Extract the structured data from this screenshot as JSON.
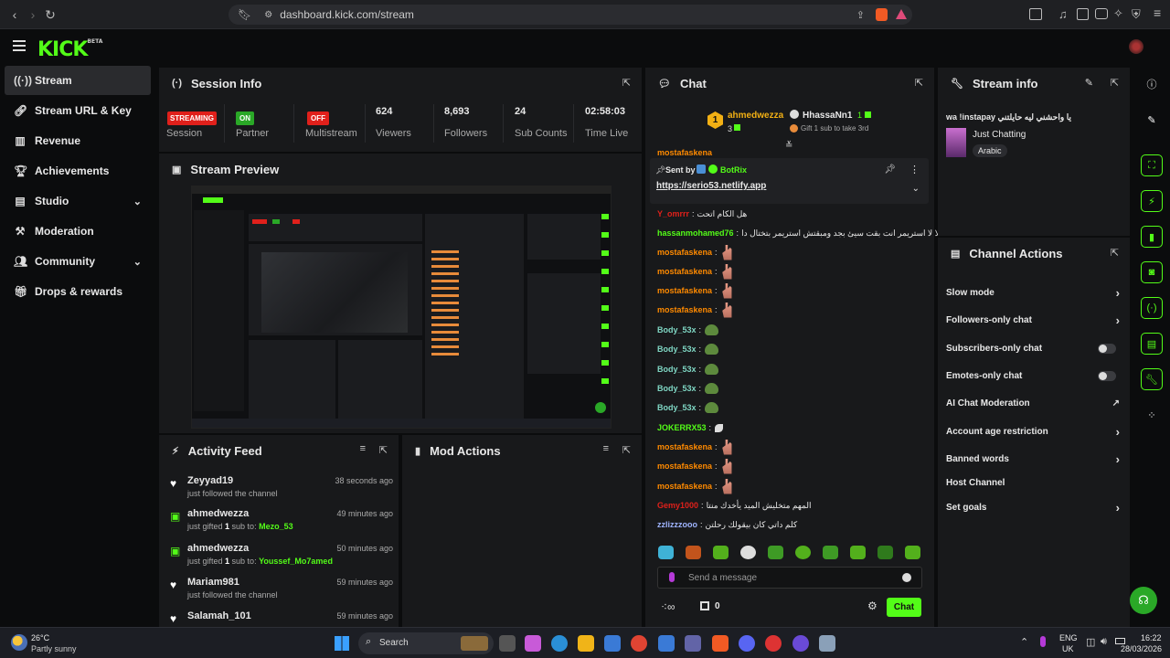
{
  "browser": {
    "url": "dashboard.kick.com/stream",
    "icons": [
      "back-icon",
      "forward-icon",
      "reload-icon",
      "bookmark-icon",
      "site-settings-icon",
      "share-icon",
      "brave-shield-icon",
      "brave-rewards-icon",
      "reader-icon",
      "music-icon",
      "sidebar-icon",
      "wallet-icon",
      "leo-icon",
      "vpn-icon"
    ]
  },
  "app": {
    "logo": "KICK",
    "logo_tag": "BETA"
  },
  "sidebar": {
    "items": [
      {
        "label": "Stream",
        "icon": "broadcast-icon",
        "active": true
      },
      {
        "label": "Stream URL & Key",
        "icon": "link-icon"
      },
      {
        "label": "Revenue",
        "icon": "chart-icon"
      },
      {
        "label": "Achievements",
        "icon": "trophy-icon"
      },
      {
        "label": "Studio",
        "icon": "film-icon",
        "chevron": true
      },
      {
        "label": "Moderation",
        "icon": "hammer-icon"
      },
      {
        "label": "Community",
        "icon": "people-icon",
        "chevron": true
      },
      {
        "label": "Drops & rewards",
        "icon": "gift-icon"
      }
    ]
  },
  "session": {
    "title": "Session Info",
    "cells": [
      {
        "value": "STREAMING",
        "label": "Session",
        "type": "badge",
        "color": "#e0201b"
      },
      {
        "value": "ON",
        "label": "Partner",
        "type": "badge",
        "color": "#2aa827"
      },
      {
        "value": "OFF",
        "label": "Multistream",
        "type": "badge",
        "color": "#e0201b"
      },
      {
        "value": "624",
        "label": "Viewers"
      },
      {
        "value": "8,693",
        "label": "Followers"
      },
      {
        "value": "24",
        "label": "Sub Counts"
      },
      {
        "value": "02:58:03",
        "label": "Time Live"
      }
    ]
  },
  "preview": {
    "title": "Stream Preview"
  },
  "activity": {
    "title": "Activity Feed",
    "rows": [
      {
        "name": "Zeyyad19",
        "text": "just followed the channel",
        "time": "38 seconds ago",
        "icon": "heart-icon"
      },
      {
        "name": "ahmedwezza",
        "text": "just gifted ",
        "count": "1",
        "text2": " sub to: ",
        "target": "Mezo_53",
        "time": "49 minutes ago",
        "icon": "gift-icon"
      },
      {
        "name": "ahmedwezza",
        "text": "just gifted ",
        "count": "1",
        "text2": " sub to: ",
        "target": "Youssef_Mo7amed",
        "time": "50 minutes ago",
        "icon": "gift-icon"
      },
      {
        "name": "Mariam981",
        "text": "just followed the channel",
        "time": "59 minutes ago",
        "icon": "heart-icon"
      },
      {
        "name": "Salamah_101",
        "text": "",
        "time": "59 minutes ago",
        "icon": "heart-icon"
      }
    ]
  },
  "mod": {
    "title": "Mod Actions"
  },
  "chat": {
    "title": "Chat",
    "gifter": {
      "rank": "1",
      "name": "ahmedwezza",
      "count": "3",
      "other": "HhassaNn1",
      "other_count": "1",
      "cta": "Gift 1 sub to take 3rd"
    },
    "pinned": {
      "prefix": "Sent by",
      "user": "BotRix",
      "link": "https://serio53.netlify.app"
    },
    "partial_top": "mostafaskena",
    "messages": [
      {
        "user": "Y_omrrr",
        "text": "هل الكام اتحت",
        "color": "#e0201b"
      },
      {
        "user": "hassanmohamed76",
        "text": "لا لا استريمر انت بقت سيئ بجد ومبقتش استريمر بتختال دا",
        "color": "#53fc18"
      },
      {
        "user": "mostafaskena",
        "emote": "hand",
        "color": "#ff8a00"
      },
      {
        "user": "mostafaskena",
        "emote": "hand",
        "color": "#ff8a00"
      },
      {
        "user": "mostafaskena",
        "emote": "hand",
        "color": "#ff8a00"
      },
      {
        "user": "mostafaskena",
        "emote": "hand",
        "color": "#ff8a00"
      },
      {
        "user": "Body_53x",
        "emote": "frog",
        "color": "#7fd6c3"
      },
      {
        "user": "Body_53x",
        "emote": "frog",
        "color": "#7fd6c3"
      },
      {
        "user": "Body_53x",
        "emote": "frog",
        "color": "#7fd6c3"
      },
      {
        "user": "Body_53x",
        "emote": "frog",
        "color": "#7fd6c3"
      },
      {
        "user": "Body_53x",
        "emote": "frog",
        "color": "#7fd6c3"
      },
      {
        "user": "JOKERRX53",
        "emote": "leaf",
        "color": "#53fc18"
      },
      {
        "user": "mostafaskena",
        "emote": "hand",
        "color": "#ff8a00"
      },
      {
        "user": "mostafaskena",
        "emote": "hand",
        "color": "#ff8a00"
      },
      {
        "user": "mostafaskena",
        "emote": "hand",
        "color": "#ff8a00"
      },
      {
        "user": "Gemy1000",
        "text": "المهم متخليش الميد يأخدك منتا",
        "color": "#e0201b"
      },
      {
        "user": "zzlizzzooo",
        "text": "كلم داتي كان بيقولك رحلتن",
        "color": "#9fb4ff"
      }
    ],
    "input_placeholder": "Send a message",
    "send_label": "Chat",
    "points": "0"
  },
  "stream_info": {
    "title": "Stream info",
    "stream_title": "wa !instapay يا واحشني ليه حايلتني",
    "category": "Just Chatting",
    "tag": "Arabic"
  },
  "channel_actions": {
    "title": "Channel Actions",
    "items": [
      {
        "label": "Slow mode",
        "control": "arrow"
      },
      {
        "label": "Followers-only chat",
        "control": "arrow"
      },
      {
        "label": "Subscribers-only chat",
        "control": "toggle"
      },
      {
        "label": "Emotes-only chat",
        "control": "toggle"
      },
      {
        "label": "AI Chat Moderation",
        "control": "external"
      },
      {
        "label": "Account age restriction",
        "control": "arrow"
      },
      {
        "label": "Banned words",
        "control": "arrow"
      },
      {
        "label": "Host Channel",
        "control": "none"
      },
      {
        "label": "Set goals",
        "control": "arrow"
      }
    ]
  },
  "taskbar": {
    "weather_temp": "26°C",
    "weather_desc": "Partly sunny",
    "search_label": "Search",
    "lang1": "ENG",
    "lang2": "UK",
    "time": "16:22",
    "date": "28/03/2026"
  },
  "colors": {
    "accent": "#53fc18",
    "panel": "#18191b",
    "bg": "#0b0c0d",
    "red": "#e0201b"
  }
}
